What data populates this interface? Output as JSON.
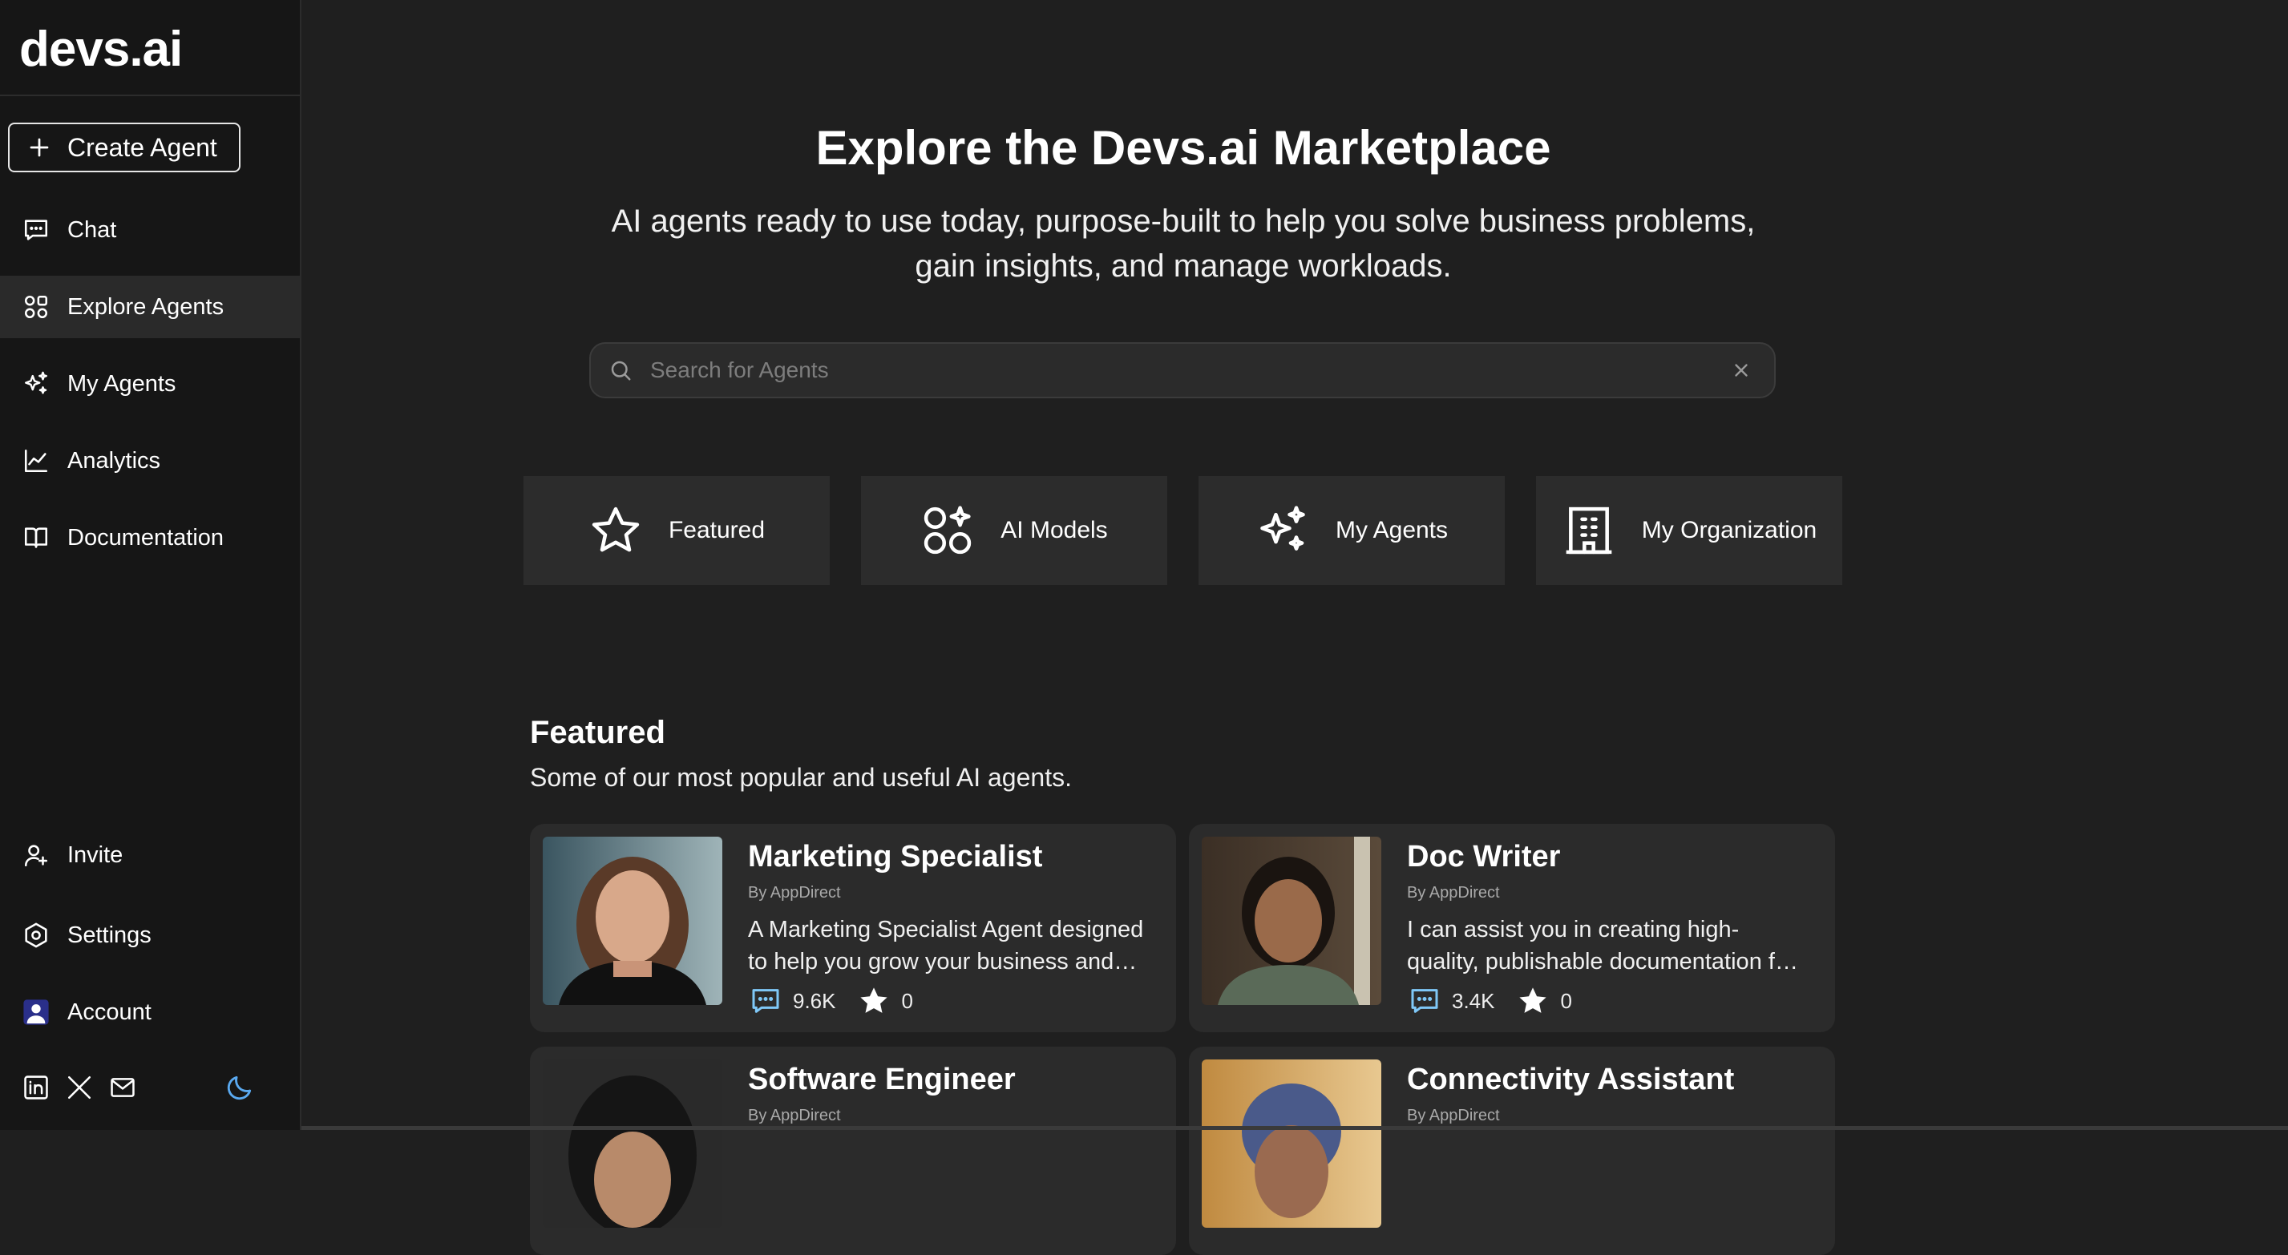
{
  "brand": {
    "logo": "devs.ai"
  },
  "sidebar": {
    "create_label": "Create Agent",
    "items": [
      {
        "label": "Chat",
        "icon": "chat-icon"
      },
      {
        "label": "Explore Agents",
        "icon": "grid-icon",
        "active": true
      },
      {
        "label": "My Agents",
        "icon": "sparkles-icon"
      },
      {
        "label": "Analytics",
        "icon": "chart-icon"
      },
      {
        "label": "Documentation",
        "icon": "book-icon"
      }
    ],
    "bottom": [
      {
        "label": "Invite",
        "icon": "user-plus-icon"
      },
      {
        "label": "Settings",
        "icon": "settings-icon"
      },
      {
        "label": "Account",
        "icon": "account-icon"
      }
    ],
    "social": [
      "linkedin-icon",
      "x-icon",
      "mail-icon"
    ],
    "theme_icon": "moon-icon"
  },
  "hero": {
    "title": "Explore the Devs.ai Marketplace",
    "subtitle_line1": "AI agents ready to use today, purpose-built to help you solve business problems,",
    "subtitle_line2": "gain insights, and manage workloads."
  },
  "search": {
    "placeholder": "Search for Agents",
    "value": ""
  },
  "categories": [
    {
      "label": "Featured",
      "icon": "star-icon"
    },
    {
      "label": "AI Models",
      "icon": "models-icon"
    },
    {
      "label": "My Agents",
      "icon": "sparkles-icon"
    },
    {
      "label": "My Organization",
      "icon": "building-icon"
    }
  ],
  "featured": {
    "title": "Featured",
    "subtitle": "Some of our most popular and useful AI agents.",
    "cards": [
      {
        "name": "Marketing Specialist",
        "by": "By AppDirect",
        "desc": "A Marketing Specialist Agent designed to help you grow your business and reach new customers.",
        "chats": "9.6K",
        "stars": "0"
      },
      {
        "name": "Doc Writer",
        "by": "By AppDirect",
        "desc": "I can assist you in creating high-quality, publishable documentation for your products.",
        "chats": "3.4K",
        "stars": "0"
      },
      {
        "name": "Software Engineer",
        "by": "By AppDirect"
      },
      {
        "name": "Connectivity Assistant",
        "by": "By AppDirect"
      }
    ]
  },
  "colors": {
    "accent": "#7fc8f8",
    "theme_moon": "#5aa9f0",
    "account_bg": "#2a2f8a"
  }
}
